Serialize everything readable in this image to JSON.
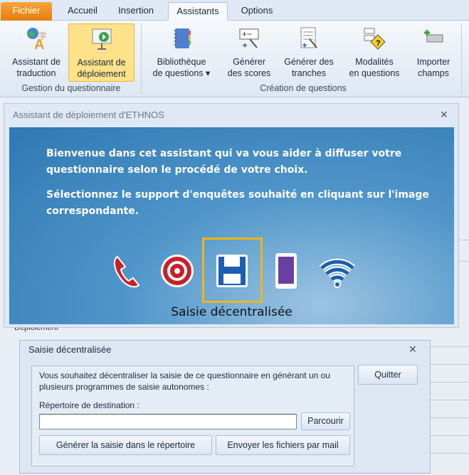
{
  "tabs": [
    "Fichier",
    "Accueil",
    "Insertion",
    "Assistants",
    "Options"
  ],
  "ribbon": {
    "buttons": [
      {
        "label1": "Assistant de",
        "label2": "traduction",
        "icon": "translation-icon"
      },
      {
        "label1": "Assistant de",
        "label2": "déploiement",
        "icon": "deployment-icon",
        "selected": true
      },
      {
        "label1": "Bibliothèque",
        "label2": "de questions ▾",
        "icon": "notebook-icon"
      },
      {
        "label1": "Générer",
        "label2": "des scores",
        "icon": "scores-wand-icon"
      },
      {
        "label1": "Générer des",
        "label2": "tranches",
        "icon": "list-wand-icon"
      },
      {
        "label1": "Modalités",
        "label2": "en questions",
        "icon": "question-diamond-icon"
      },
      {
        "label1": "Importer",
        "label2": "champs",
        "icon": "add-field-icon"
      }
    ],
    "groups": [
      "Gestion du questionnaire",
      "Création de questions"
    ]
  },
  "background_label": "Déploiement",
  "wizard": {
    "title": "Assistant de déploiement d'ETHNOS",
    "para1": "Bienvenue dans cet assistant qui va vous aider à diffuser votre questionnaire selon le procédé de votre choix.",
    "para2": "Sélectionnez le support d'enquêtes souhaité en cliquant sur l'image correspondante.",
    "supports": [
      "phone-icon",
      "target-icon",
      "floppy-disk-icon",
      "tablet-icon",
      "wifi-icon"
    ],
    "selected_label": "Saisie décentralisée",
    "accent": "#f2b516"
  },
  "dialog": {
    "title": "Saisie décentralisée",
    "description": "Vous souhaitez décentraliser la saisie de ce questionnaire en générant un ou plusieurs programmes de saisie autonomes :",
    "dest_label": "Répertoire de destination :",
    "dest_value": "",
    "browse": "Parcourir",
    "generate": "Générer la saisie dans le répertoire",
    "send": "Envoyer les fichiers par mail",
    "quit": "Quitter"
  }
}
